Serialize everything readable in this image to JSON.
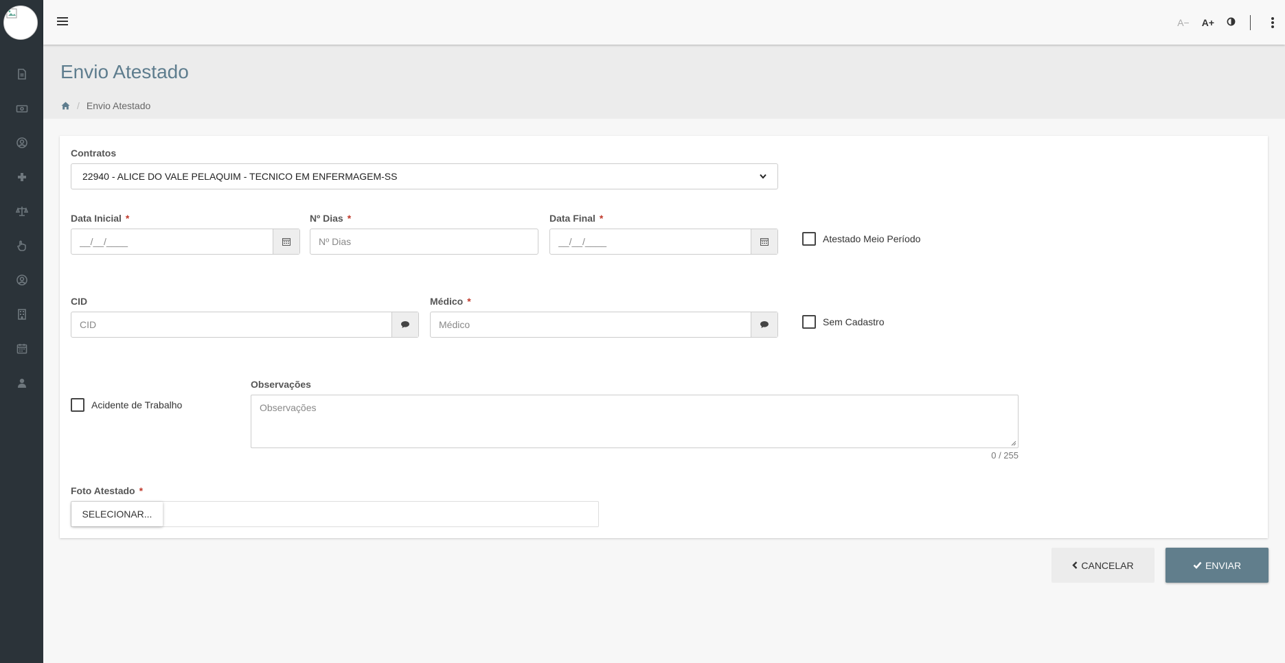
{
  "header": {
    "font_decrease": "A−",
    "font_increase": "A+"
  },
  "page": {
    "title": "Envio Atestado",
    "breadcrumb_current": "Envio Atestado"
  },
  "form": {
    "contratos_label": "Contratos",
    "contratos_selected": "22940 - ALICE DO VALE PELAQUIM - TECNICO EM ENFERMAGEM-SS",
    "data_inicial_label": "Data Inicial",
    "data_inicial_mask": "__/__/____",
    "n_dias_label": "Nº Dias",
    "n_dias_placeholder": "Nº Dias",
    "data_final_label": "Data Final",
    "data_final_mask": "__/__/____",
    "meio_periodo_label": "Atestado Meio Período",
    "cid_label": "CID",
    "cid_placeholder": "CID",
    "medico_label": "Médico",
    "medico_placeholder": "Médico",
    "sem_cadastro_label": "Sem Cadastro",
    "acidente_label": "Acidente de Trabalho",
    "observacoes_label": "Observações",
    "observacoes_placeholder": "Observações",
    "observacoes_counter": "0 / 255",
    "foto_label": "Foto Atestado",
    "foto_button": "SELECIONAR...",
    "required_mark": "*"
  },
  "actions": {
    "cancel_label": "CANCELAR",
    "send_label": "ENVIAR"
  },
  "colors": {
    "sidebar": "#2b3339",
    "accent": "#617e8c",
    "title": "#5e7d8e",
    "required": "#c0392b"
  }
}
